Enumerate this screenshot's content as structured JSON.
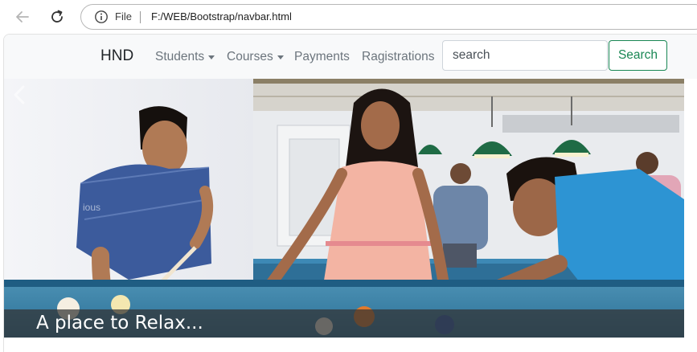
{
  "browser": {
    "file_label": "File",
    "url": "F:/WEB/Bootstrap/navbar.html"
  },
  "navbar": {
    "brand": "HND",
    "links": [
      {
        "label": "Students",
        "dropdown": true
      },
      {
        "label": "Courses",
        "dropdown": true
      },
      {
        "label": "Payments",
        "dropdown": false
      },
      {
        "label": "Ragistrations",
        "dropdown": false
      }
    ],
    "search": {
      "placeholder": "search",
      "button_label": "Search"
    },
    "colors": {
      "background": "#f8f9fa",
      "search_button": "#198754"
    }
  },
  "carousel": {
    "prev_label": "ious",
    "caption": "A place to Relax..."
  }
}
